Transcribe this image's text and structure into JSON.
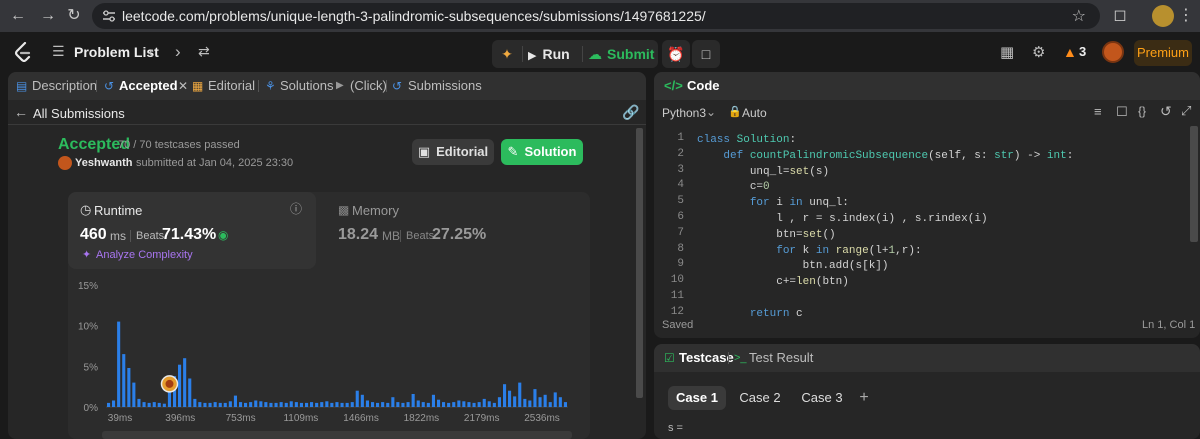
{
  "browser": {
    "url": "leetcode.com/problems/unique-length-3-palindromic-subsequences/submissions/1497681225/"
  },
  "header": {
    "problem_list": "Problem List",
    "run": "Run",
    "submit": "Submit",
    "streak": "3",
    "premium": "Premium"
  },
  "left_tabs": {
    "description": "Description",
    "accepted": "Accepted",
    "editorial": "Editorial",
    "solutions": "Solutions",
    "click": "(Click)",
    "submissions": "Submissions"
  },
  "submission": {
    "back": "All Submissions",
    "status": "Accepted",
    "testcases": "70 / 70 testcases passed",
    "user": "Yeshwanth",
    "submitted_at": "submitted at Jan 04, 2025 23:30",
    "editorial_btn": "Editorial",
    "solution_btn": "Solution",
    "runtime_label": "Runtime",
    "runtime_value": "460",
    "runtime_unit": "ms",
    "beats_label": "Beats",
    "runtime_beats": "71.43%",
    "analyze": "Analyze Complexity",
    "memory_label": "Memory",
    "memory_value": "18.24",
    "memory_unit": "MB",
    "memory_beats": "27.25%"
  },
  "chart_data": {
    "type": "bar",
    "yticks": [
      "15%",
      "10%",
      "5%",
      "0%"
    ],
    "xticks": [
      "39ms",
      "396ms",
      "753ms",
      "1109ms",
      "1466ms",
      "1822ms",
      "2179ms",
      "2536ms"
    ],
    "values": [
      0.5,
      0.8,
      10.5,
      6.5,
      4.8,
      3.0,
      1.0,
      0.6,
      0.5,
      0.6,
      0.5,
      0.4,
      2.6,
      3.8,
      5.2,
      6.0,
      3.5,
      1.0,
      0.6,
      0.5,
      0.5,
      0.6,
      0.5,
      0.5,
      0.7,
      1.4,
      0.6,
      0.5,
      0.6,
      0.8,
      0.7,
      0.6,
      0.5,
      0.5,
      0.6,
      0.5,
      0.7,
      0.6,
      0.5,
      0.5,
      0.6,
      0.5,
      0.6,
      0.7,
      0.5,
      0.6,
      0.5,
      0.5,
      0.6,
      2.0,
      1.5,
      0.8,
      0.6,
      0.5,
      0.6,
      0.5,
      1.2,
      0.6,
      0.5,
      0.6,
      1.6,
      0.8,
      0.6,
      0.5,
      1.5,
      0.9,
      0.6,
      0.5,
      0.6,
      0.8,
      0.7,
      0.6,
      0.5,
      0.6,
      1.0,
      0.7,
      0.5,
      1.2,
      2.8,
      2.0,
      1.3,
      3.0,
      1.0,
      0.8,
      2.2,
      1.2,
      1.5,
      0.6,
      1.8,
      1.2,
      0.6
    ],
    "highlight_index": 12,
    "ymax": 15,
    "bar_color": "#2b7fe8",
    "highlight_color": "#e59d2e"
  },
  "code_panel": {
    "title": "Code",
    "language": "Python3",
    "auto": "Auto",
    "status": "Saved",
    "cursor": "Ln 1, Col 1",
    "lines": [
      "class Solution:",
      "    def countPalindromicSubsequence(self, s: str) -> int:",
      "        unq_l=set(s)",
      "        c=0",
      "        for i in unq_l:",
      "            l , r = s.index(i) , s.rindex(i)",
      "            btn=set()",
      "            for k in range(l+1,r):",
      "                btn.add(s[k])",
      "            c+=len(btn)",
      "",
      "        return c"
    ]
  },
  "test_panel": {
    "testcase_tab": "Testcase",
    "result_tab": "Test Result",
    "cases": [
      "Case 1",
      "Case 2",
      "Case 3"
    ],
    "add": "+",
    "input_label": "s ="
  }
}
